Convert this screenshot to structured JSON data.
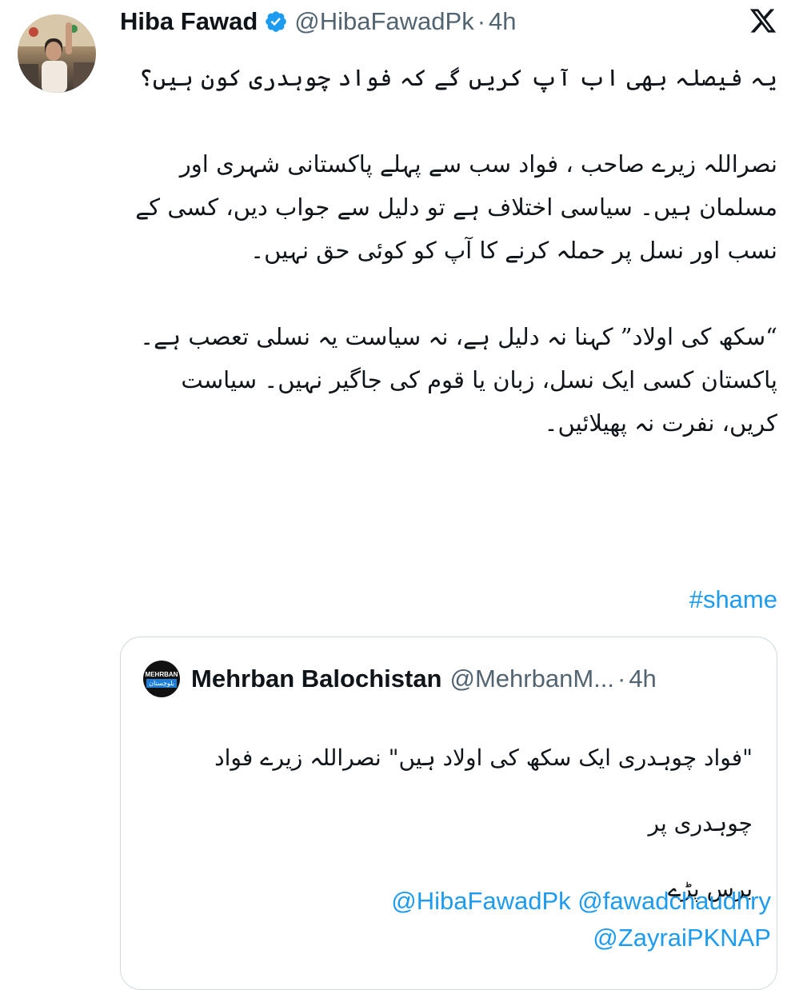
{
  "tweet": {
    "display_name": "Hiba Fawad",
    "handle": "@HibaFawadPk",
    "separator": "·",
    "time": "4h",
    "paragraphs": [
      "یہ فیصلہ بھی اب آپ کریں گے کہ فواد چوہدری کون ہیں؟",
      "نصراللہ زیرے صاحب ، فواد سب سے پہلے پاکستانی شہری اور مسلمان ہیں۔ سیاسی اختلاف ہے تو دلیل سے جواب دیں، کسی کے نسب اور نسل پر حملہ کرنے کا آپ کو کوئی حق نہیں۔",
      "“سکھ کی اولاد” کہنا نہ دلیل ہے، نہ سیاست یہ نسلی تعصب ہے۔ پاکستان کسی ایک نسل، زبان یا قوم کی جاگیر نہیں۔ سیاست کریں، نفرت نہ پھیلائیں۔"
    ],
    "hashtag": "#shame"
  },
  "quoted_tweet": {
    "display_name": "Mehrban Balochistan",
    "handle": "@MehrbanM...",
    "separator": "·",
    "time": "4h",
    "avatar_text_1": "MEHRBAN",
    "avatar_text_2": "بلوچستان",
    "text_line_1": "\"فواد چوہدری ایک سکھ کی اولاد ہیں\" نصراللہ زیرے فواد چوہدری پر",
    "text_line_2": "برس پڑے",
    "mentions_line_1": "@HibaFawadPk @fawadchaudhry",
    "mentions_line_2": "@ZayraiPKNAP"
  },
  "colors": {
    "link": "#1d9bf0",
    "secondary_text": "#536471",
    "primary_text": "#0f1419",
    "border": "#cfd9de"
  },
  "icons": [
    "verified-badge-icon",
    "x-logo-icon"
  ]
}
